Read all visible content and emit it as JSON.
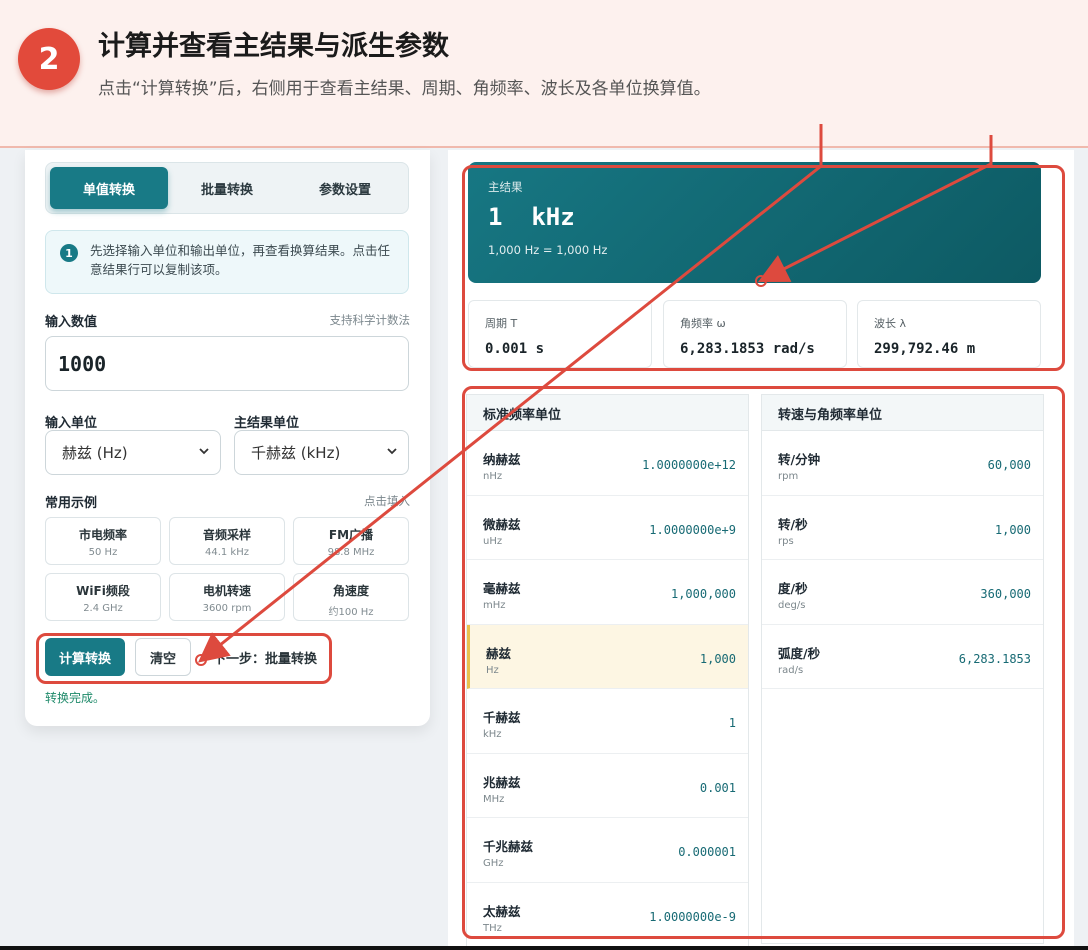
{
  "banner": {
    "step": "2",
    "title": "计算并查看主结果与派生参数",
    "subtitle": "点击“计算转换”后，右侧用于查看主结果、周期、角频率、波长及各单位换算值。"
  },
  "tabs": [
    "单值转换",
    "批量转换",
    "参数设置"
  ],
  "hint": {
    "number": "1",
    "text": "先选择输入单位和输出单位，再查看换算结果。点击任意结果行可以复制该项。"
  },
  "input": {
    "label": "输入数值",
    "note": "支持科学计数法",
    "value": "1000"
  },
  "input_unit": {
    "label": "输入单位",
    "value": "赫兹 (Hz)"
  },
  "result_unit": {
    "label": "主结果单位",
    "value": "千赫兹 (kHz)"
  },
  "examples": {
    "label": "常用示例",
    "note": "点击填入",
    "items": [
      {
        "name": "市电频率",
        "value": "50 Hz"
      },
      {
        "name": "音频采样",
        "value": "44.1 kHz"
      },
      {
        "name": "FM广播",
        "value": "98.8 MHz"
      },
      {
        "name": "WiFi频段",
        "value": "2.4 GHz"
      },
      {
        "name": "电机转速",
        "value": "3600 rpm"
      },
      {
        "name": "角速度",
        "value": "约100 Hz"
      }
    ]
  },
  "actions": {
    "compute": "计算转换",
    "clear": "清空",
    "next": "下一步：批量转换",
    "status": "转换完成。"
  },
  "main_result": {
    "label": "主结果",
    "value": "1  kHz",
    "detail": "1,000 Hz = 1,000 Hz"
  },
  "derived": [
    {
      "label": "周期 T",
      "value": "0.001 s"
    },
    {
      "label": "角频率 ω",
      "value": "6,283.1853 rad/s"
    },
    {
      "label": "波长 λ",
      "value": "299,792.46 m"
    }
  ],
  "freq_table": {
    "title": "标准频率单位",
    "rows": [
      {
        "name": "纳赫兹",
        "unit": "nHz",
        "value": "1.0000000e+12"
      },
      {
        "name": "微赫兹",
        "unit": "uHz",
        "value": "1.0000000e+9"
      },
      {
        "name": "毫赫兹",
        "unit": "mHz",
        "value": "1,000,000"
      },
      {
        "name": "赫兹",
        "unit": "Hz",
        "value": "1,000"
      },
      {
        "name": "千赫兹",
        "unit": "kHz",
        "value": "1"
      },
      {
        "name": "兆赫兹",
        "unit": "MHz",
        "value": "0.001"
      },
      {
        "name": "千兆赫兹",
        "unit": "GHz",
        "value": "0.000001"
      },
      {
        "name": "太赫兹",
        "unit": "THz",
        "value": "1.0000000e-9"
      }
    ]
  },
  "rot_table": {
    "title": "转速与角频率单位",
    "rows": [
      {
        "name": "转/分钟",
        "unit": "rpm",
        "value": "60,000"
      },
      {
        "name": "转/秒",
        "unit": "rps",
        "value": "1,000"
      },
      {
        "name": "度/秒",
        "unit": "deg/s",
        "value": "360,000"
      },
      {
        "name": "弧度/秒",
        "unit": "rad/s",
        "value": "6,283.1853"
      }
    ]
  },
  "colors": {
    "accent": "#187a86",
    "annotation": "#dd4a3e",
    "highlight_row": "#fdf6e3"
  }
}
